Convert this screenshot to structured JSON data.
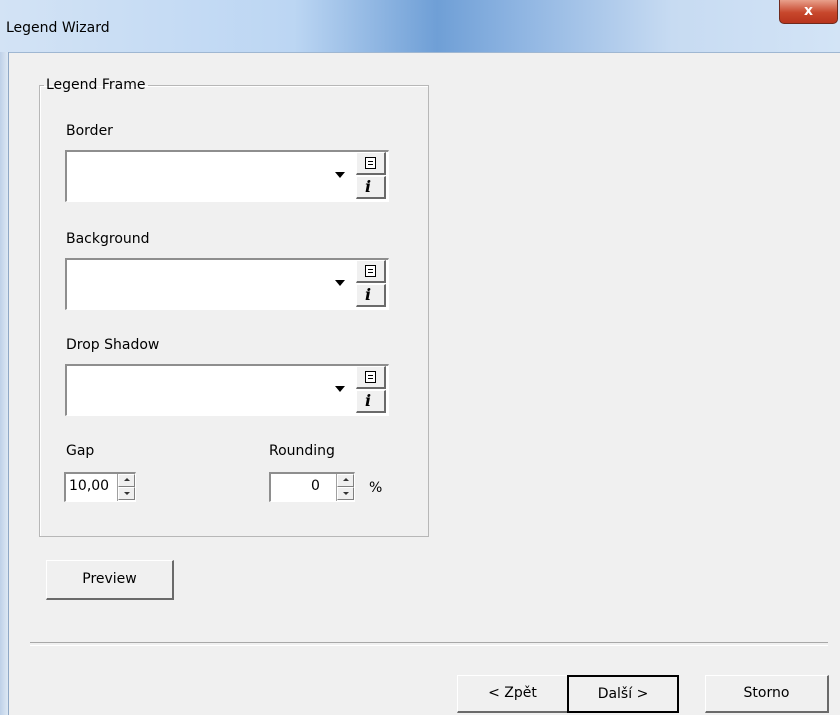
{
  "window": {
    "title": "Legend Wizard",
    "close_glyph": "x"
  },
  "frame": {
    "legend": "Legend Frame"
  },
  "fields": {
    "border": {
      "label": "Border",
      "value": ""
    },
    "background": {
      "label": "Background",
      "value": ""
    },
    "drop_shadow": {
      "label": "Drop Shadow",
      "value": ""
    }
  },
  "icons": {
    "dropdown": "chevron-down-icon",
    "list": "list-icon",
    "info": "info-icon",
    "info_glyph": "i"
  },
  "gap": {
    "label": "Gap",
    "value": "10,00"
  },
  "rounding": {
    "label": "Rounding",
    "value": "0",
    "unit": "%"
  },
  "buttons": {
    "preview": "Preview",
    "back": "< Zpět",
    "next": "Další >",
    "cancel": "Storno"
  },
  "colors": {
    "title_bar_accent": "#6f9fd6",
    "close_button": "#c7472c"
  }
}
